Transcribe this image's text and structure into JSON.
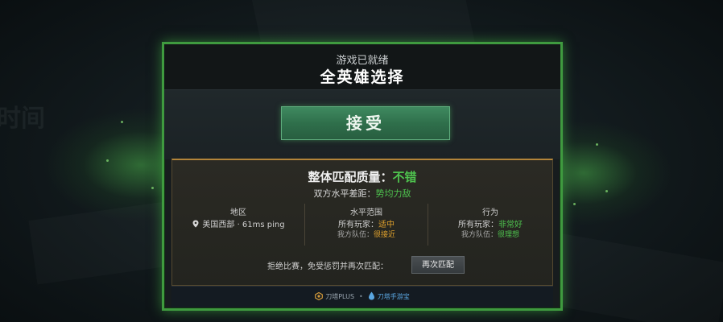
{
  "background": {
    "faded_text": "时间"
  },
  "dialog": {
    "status": "游戏已就绪",
    "mode": "全英雄选择",
    "accept_label": "接受",
    "accent_color": "#3f9a3f"
  },
  "match_quality": {
    "label": "整体匹配质量：",
    "value": "不错",
    "diff_label": "双方水平差距：",
    "diff_value": "势均力敌"
  },
  "stats": {
    "region": {
      "heading": "地区",
      "value": "美国西部 · 61ms ping",
      "icon": "location-pin-icon"
    },
    "skill": {
      "heading": "水平范围",
      "line1_label": "所有玩家：",
      "line1_value": "适中",
      "line2_label": "我方队伍：",
      "line2_value": "很接近"
    },
    "behavior": {
      "heading": "行为",
      "line1_label": "所有玩家：",
      "line1_value": "非常好",
      "line2_label": "我方队伍：",
      "line2_value": "很理想"
    }
  },
  "decline": {
    "text": "拒绝比赛，免受惩罚并再次匹配：",
    "button_label": "再次匹配"
  },
  "footer": {
    "plus_label": "刀塔PLUS",
    "separator": "•",
    "secondary_label": "刀塔手游宝",
    "plus_icon": "dota-plus-icon",
    "secondary_icon": "droplet-icon"
  }
}
